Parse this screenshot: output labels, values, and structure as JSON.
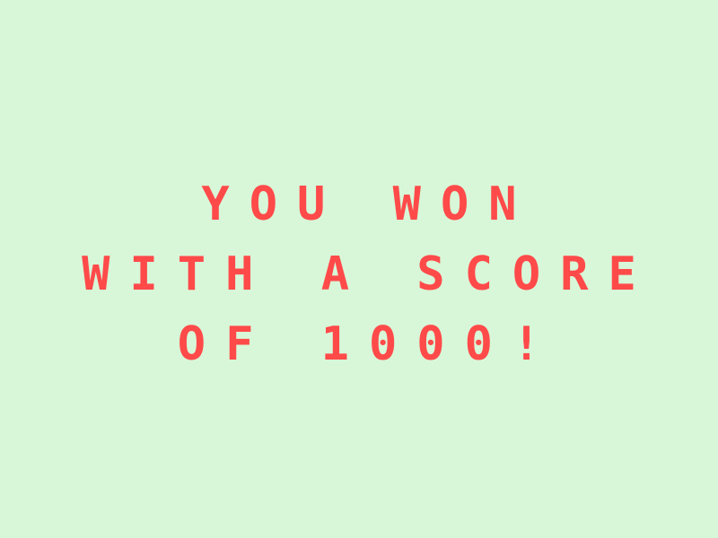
{
  "colors": {
    "background": "#d8f7d8",
    "text": "#ff4a4a"
  },
  "message": {
    "lines": [
      "YOU WON",
      "WITH A SCORE",
      "OF 1000!"
    ]
  }
}
